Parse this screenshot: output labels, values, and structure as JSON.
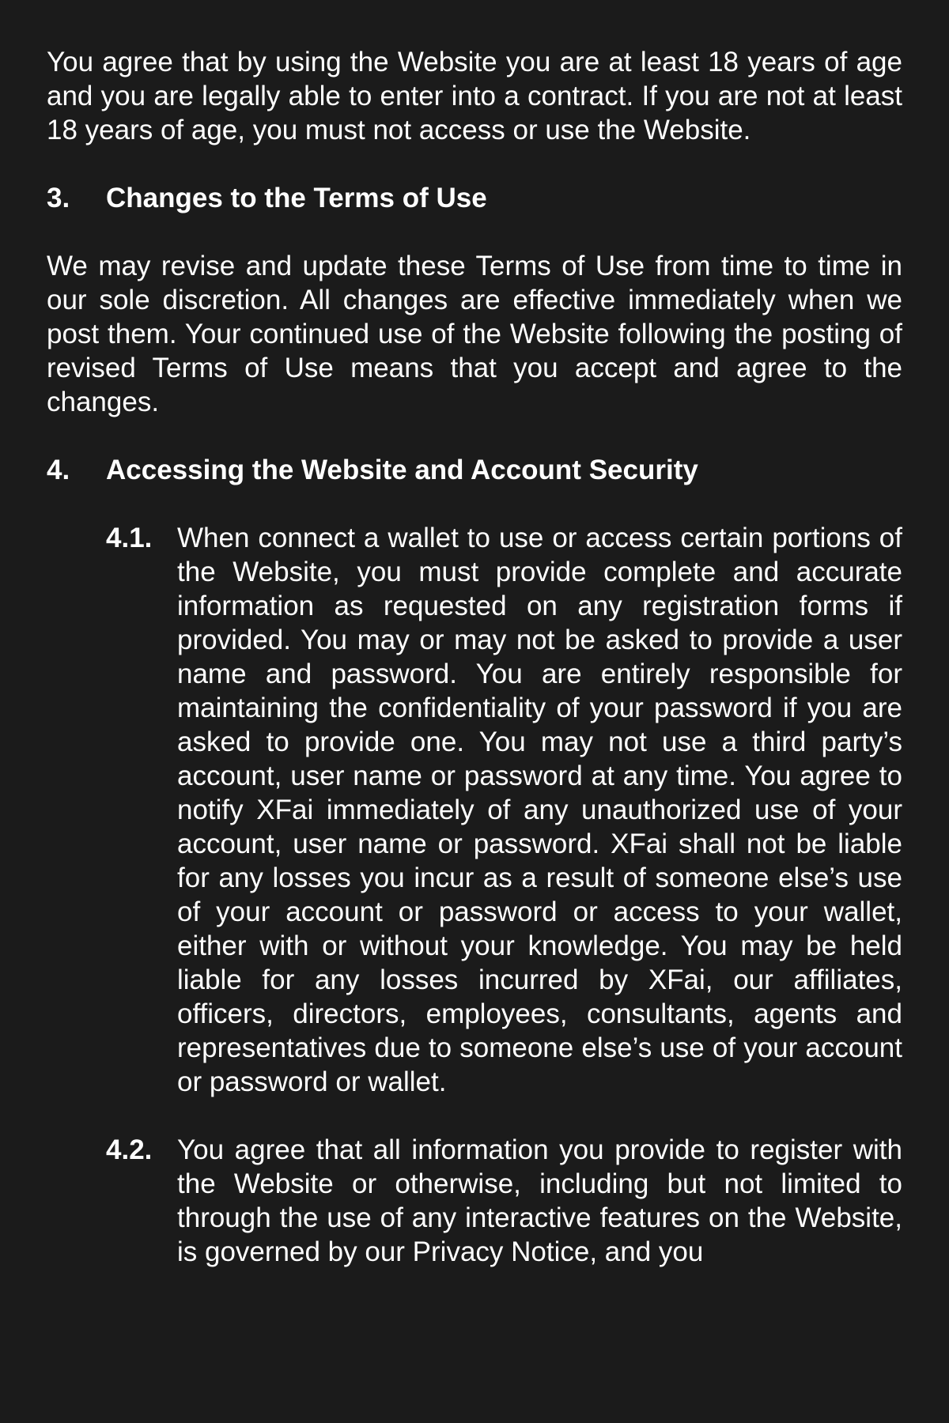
{
  "intro_paragraph": "You agree that by using the Website you are at least 18 years of age and you are legally able to enter into a contract. If you are not at least 18 years of age, you must not access or use the Website.",
  "section3": {
    "number": "3.",
    "title": "Changes to the Terms of Use",
    "body": "We may revise and update these Terms of Use from time to time in our sole discretion. All changes are effective immediately when we post them. Your continued use of the Website following the posting of revised Terms of Use means that you accept and agree to the changes."
  },
  "section4": {
    "number": "4.",
    "title": "Accessing the Website and Account Security",
    "subsections": [
      {
        "number": "4.1.",
        "text": "When connect a wallet to use or access certain portions of the Website, you must provide complete and accurate information as requested on any registration forms if provided. You may or may not be asked to provide a user name and password. You are entirely responsible for maintaining the confidentiality of your password if you are asked to provide one. You may not use a third party’s account, user name or password at any time. You agree to notify XFai immediately of any unauthorized use of your account, user name or password. XFai shall not be liable for any losses you incur as a result of someone else’s use of your account or password or access to your wallet, either with or without your knowledge. You may be held liable for any losses incurred by XFai, our affiliates, officers, directors, employees, consultants, agents and representatives due to someone else’s use of your account or password or wallet."
      },
      {
        "number": "4.2.",
        "text": "You agree that all information you provide to register with the Website or otherwise, including but not limited to through the use of any interactive features on the Website, is governed by our Privacy Notice, and you"
      }
    ]
  }
}
